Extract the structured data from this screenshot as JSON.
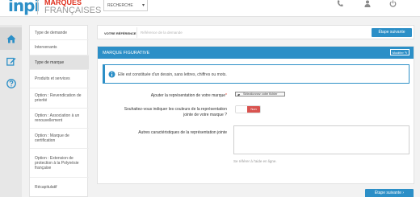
{
  "header": {
    "logo_mark": "inpi",
    "logo_line1": "MARQUES",
    "logo_line2": "FRANÇAISES",
    "search_label": "RECHERCHE",
    "icons": [
      "phone-icon",
      "user-icon",
      "power-icon"
    ]
  },
  "rail": {
    "icons": [
      "home-icon",
      "edit-icon",
      "help-icon"
    ]
  },
  "sidenav": {
    "items": [
      {
        "label": "Type de demande"
      },
      {
        "label": "Intervenants"
      },
      {
        "label": "Type de marque"
      },
      {
        "label": "Produits et services"
      },
      {
        "label": "Option : Revendication de priorité"
      },
      {
        "label": "Option : Association à un renouvellement"
      },
      {
        "label": "Option : Marque de certification"
      },
      {
        "label": "Option : Extension de protection à la Polynésie française"
      },
      {
        "label": "Récapitulatif"
      }
    ],
    "active_index": 2
  },
  "reference": {
    "label": "VOTRE RÉFÉRENCE",
    "placeholder": "Référence de la demande",
    "next_button": "Étape suivante"
  },
  "panel": {
    "title": "MARQUE FIGURATIVE",
    "modify_button": "Modifier",
    "info_text": "Elle est constituée d'un dessin, sans lettres, chiffres ou mots.",
    "upload_label": "Ajouter la représentation de votre marque",
    "required_mark": "*",
    "upload_button": "Sélectionnez votre fichier",
    "colors_question_line1": "Souhaitez-vous indiquer les couleurs de la représentation",
    "colors_question_line2": "jointe de votre marque ?",
    "toggle_value": "Non",
    "characteristics_label": "Autres caractéristiques de la représentation jointe",
    "help_text": "Se référer à l'aide en ligne."
  },
  "footer": {
    "next_button": "Étape suivante"
  },
  "colors": {
    "accent": "#2c8fc7",
    "danger": "#d9534f",
    "brand_red": "#e0301e"
  }
}
